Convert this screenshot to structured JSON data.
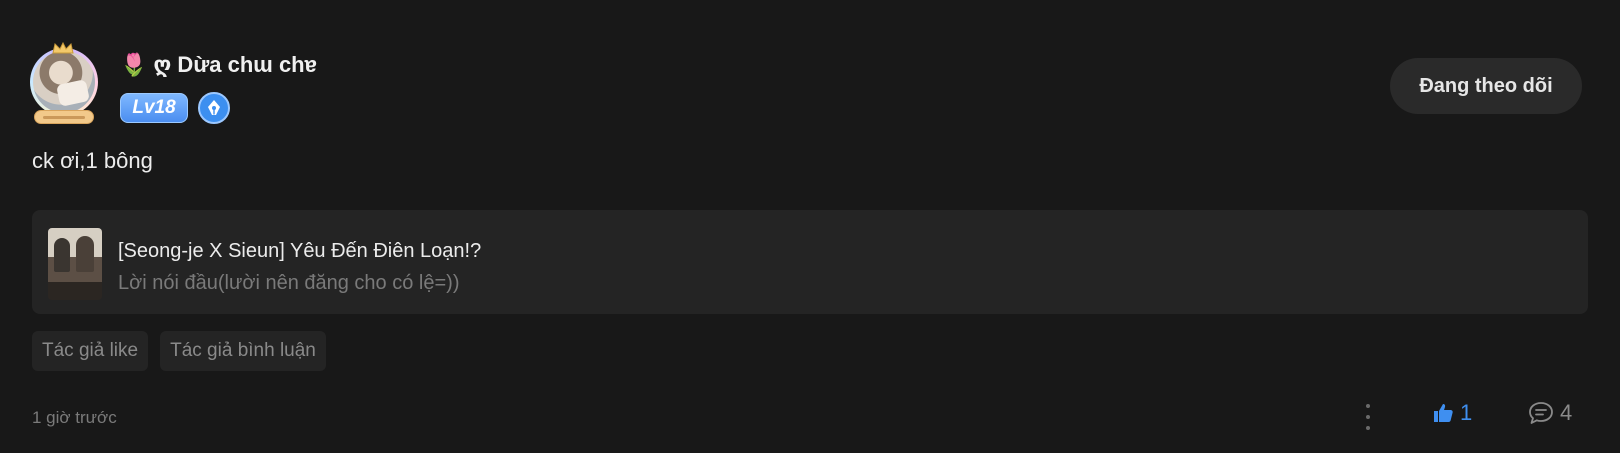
{
  "author": {
    "name_emoji": "🌷",
    "name": "ღ Dừa chɯ chɐ",
    "level": "Lv18",
    "writer_badge_icon": "pen-nib-icon"
  },
  "follow_button": {
    "label": "Đang theo dõi"
  },
  "post": {
    "text": "ck ơi,1 bông"
  },
  "book_card": {
    "title": "[Seong-je X Sieun] Yêu Đến Điên Loạn!?",
    "chapter": "Lời nói đầu(lười nên đăng cho có lệ=))"
  },
  "tags": [
    "Tác giả like",
    "Tác giả bình luận"
  ],
  "footer": {
    "timestamp": "1 giờ trước",
    "like_count": "1",
    "comment_count": "4"
  },
  "colors": {
    "background": "#181818",
    "card": "#242424",
    "accent_blue": "#3f8ff0",
    "muted_text": "#7a7a7a"
  }
}
